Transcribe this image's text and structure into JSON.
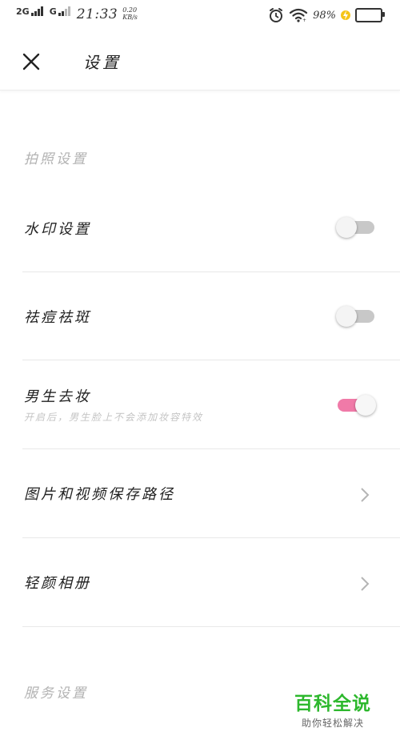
{
  "status_bar": {
    "sig1_label": "2G",
    "sig2_label": "G",
    "time": "21:33",
    "speed_value": "0.20",
    "speed_unit": "KB/s",
    "battery_percent": "98%",
    "battery_color": "#2ecc40"
  },
  "header": {
    "title": "设置",
    "close_icon": "close-icon"
  },
  "sections": {
    "photo": {
      "label": "拍照设置"
    },
    "service": {
      "label": "服务设置"
    }
  },
  "rows": {
    "watermark": {
      "title": "水印设置",
      "toggle": false
    },
    "acne": {
      "title": "祛痘祛斑",
      "toggle": false
    },
    "male_makeup": {
      "title": "男生去妆",
      "subtitle": "开启后，男生脸上不会添加妆容特效",
      "toggle": true
    },
    "save_path": {
      "title": "图片和视频保存路径",
      "icon": "chevron-right-icon"
    },
    "light_album": {
      "title": "轻颜相册",
      "icon": "chevron-right-icon"
    }
  },
  "colors": {
    "toggle_on": "#f07aa8",
    "toggle_off": "#c8c8c8"
  },
  "watermark_logo": {
    "main": "百科全说",
    "sub": "助你轻松解决"
  }
}
